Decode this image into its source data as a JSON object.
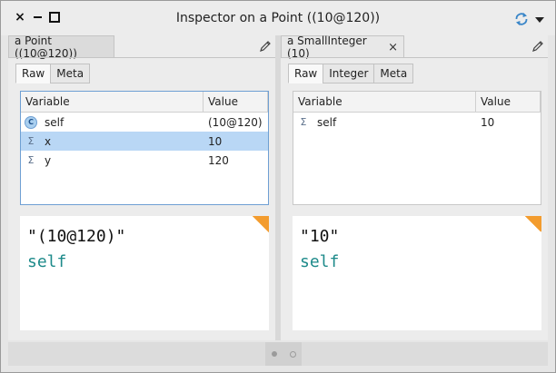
{
  "window": {
    "title": "Inspector on a Point ((10@120))",
    "close_glyph": "×",
    "accent_color": "#3a86c8"
  },
  "left_pane": {
    "tab_label": "a Point ((10@120))",
    "subtabs": [
      "Raw",
      "Meta"
    ],
    "active_subtab": "Raw",
    "columns": {
      "variable": "Variable",
      "value": "Value"
    },
    "rows": [
      {
        "icon": "C",
        "name": "self",
        "value": "(10@120)"
      },
      {
        "icon": "Σ",
        "name": "x",
        "value": "10"
      },
      {
        "icon": "Σ",
        "name": "y",
        "value": "120"
      }
    ],
    "selected_row": 1,
    "code": {
      "line1": "\"(10@120)\"",
      "line2": "self"
    }
  },
  "right_pane": {
    "tab_label": "a SmallInteger (10)",
    "tab_close": "×",
    "subtabs": [
      "Raw",
      "Integer",
      "Meta"
    ],
    "active_subtab": "Raw",
    "columns": {
      "variable": "Variable",
      "value": "Value"
    },
    "rows": [
      {
        "icon": "Σ",
        "name": "self",
        "value": "10"
      }
    ],
    "code": {
      "line1": "\"10\"",
      "line2": "self"
    }
  },
  "pager": {
    "page_count": 2,
    "current_page": 1
  }
}
